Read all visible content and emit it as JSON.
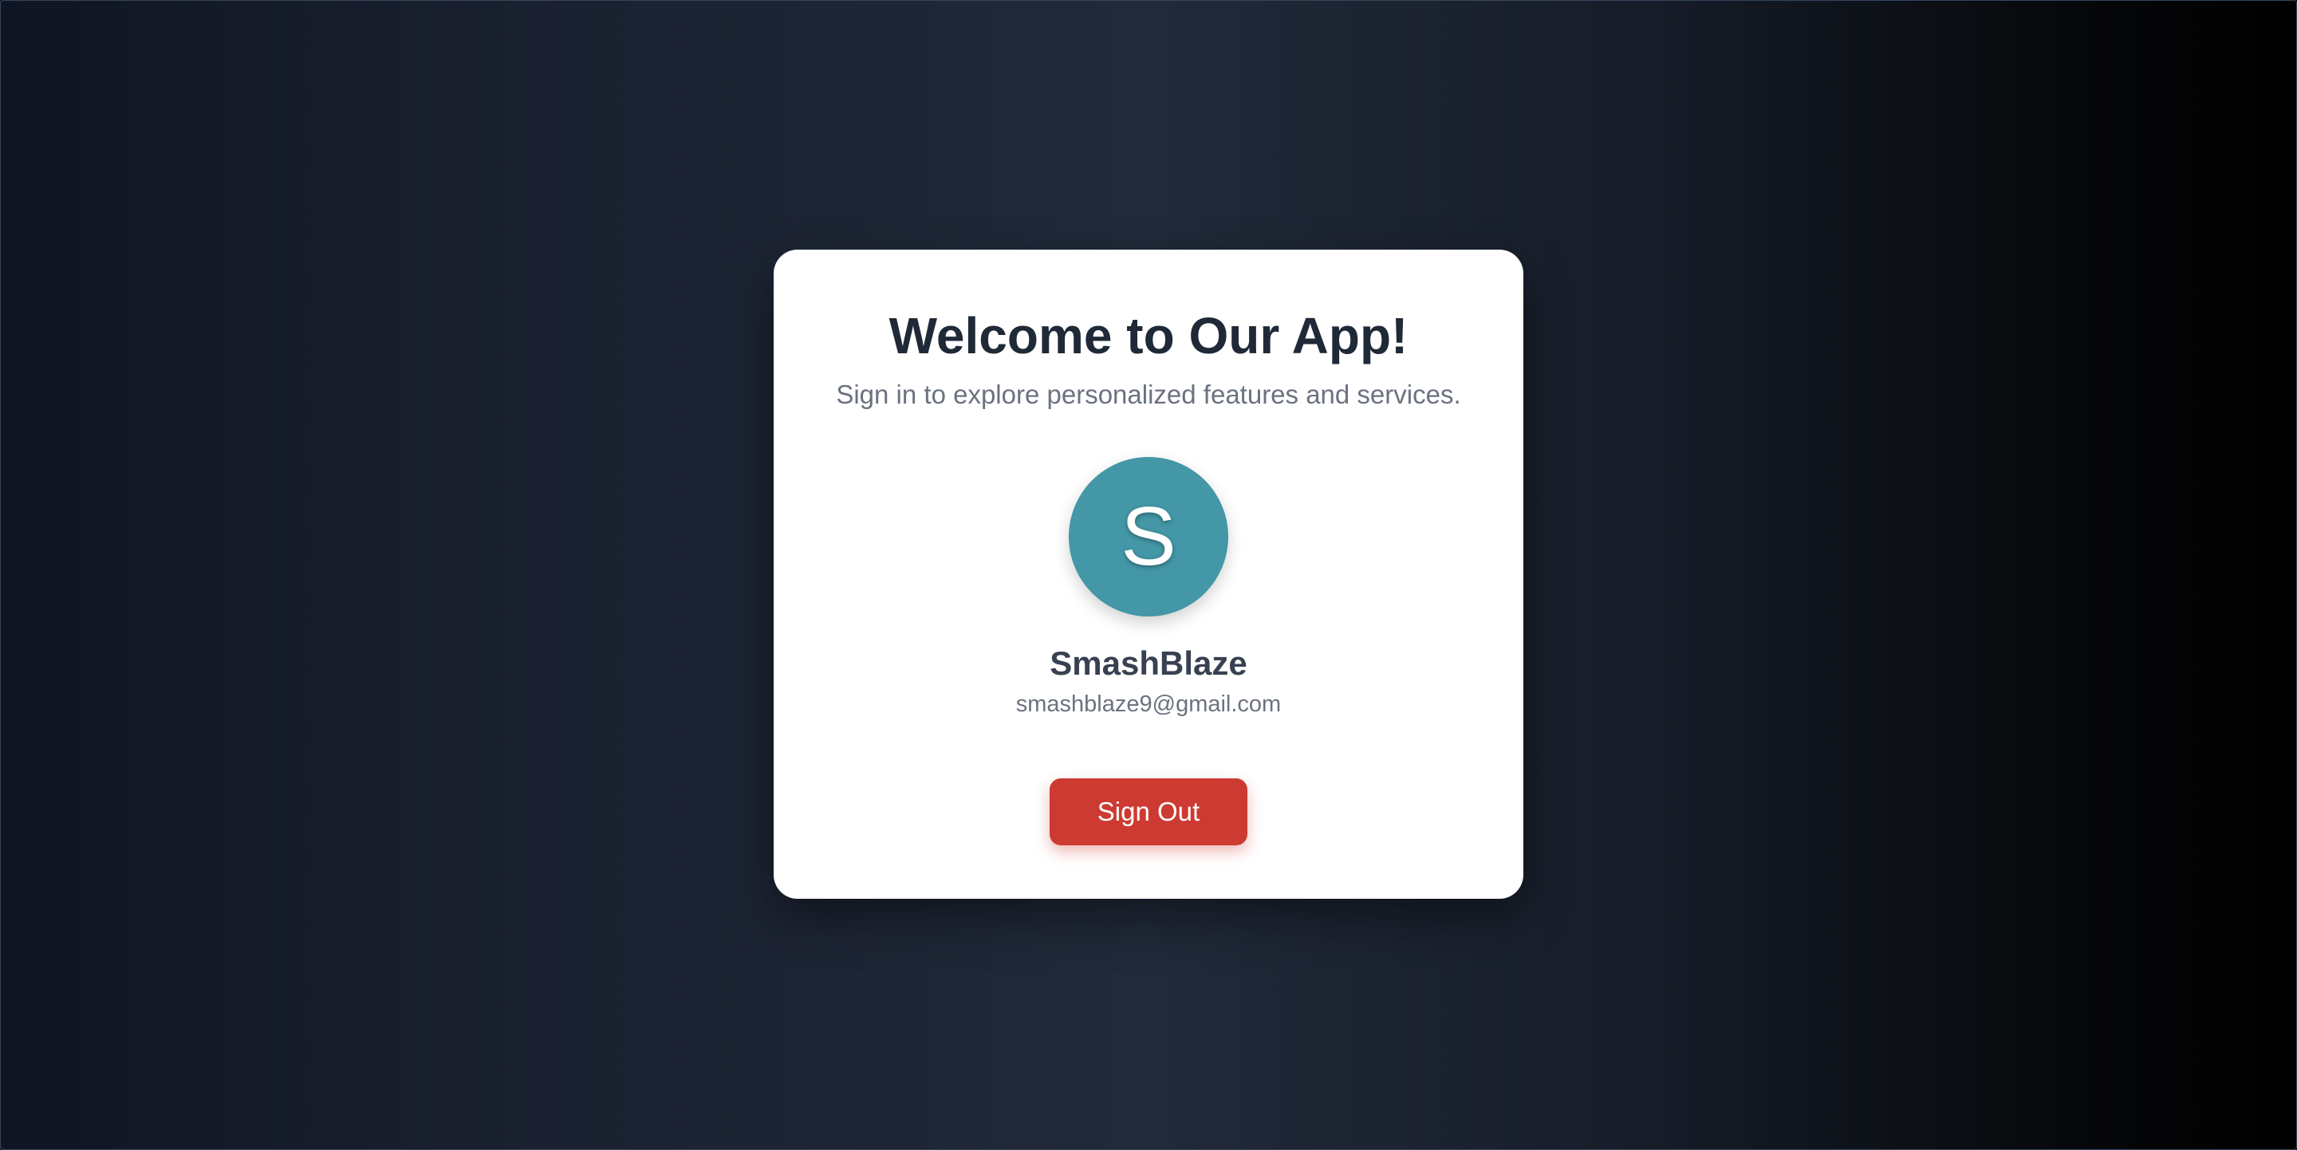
{
  "card": {
    "title": "Welcome to Our App!",
    "subtitle": "Sign in to explore personalized features and services."
  },
  "user": {
    "avatar_initial": "S",
    "avatar_color": "#4397a6",
    "name": "SmashBlaze",
    "email": "smashblaze9@gmail.com"
  },
  "actions": {
    "sign_out_label": "Sign Out",
    "sign_out_color": "#cd3a32"
  }
}
